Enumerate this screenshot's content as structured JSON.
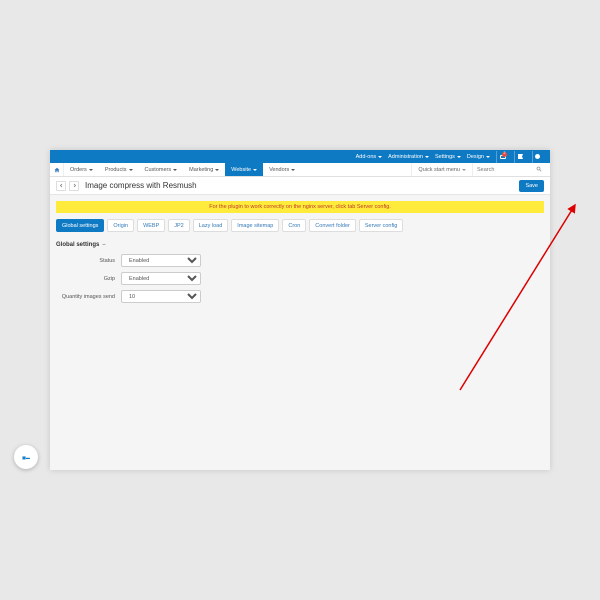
{
  "topbar": {
    "addons": "Add-ons",
    "administration": "Administration",
    "settings": "Settings",
    "design": "Design",
    "cart_badge": "2"
  },
  "nav": {
    "orders": "Orders",
    "products": "Products",
    "customers": "Customers",
    "marketing": "Marketing",
    "website": "Website",
    "vendors": "Vendors",
    "quick_start": "Quick start menu"
  },
  "search": {
    "placeholder": "Search"
  },
  "page": {
    "title": "Image compress with Resmush"
  },
  "actions": {
    "save": "Save"
  },
  "alert": {
    "text": "For the plugin to work correctly on the nginx server, click tab Server config."
  },
  "tabs": {
    "global": "Global settings",
    "origin": "Origin",
    "webp": "WEBP",
    "jp2": "JP2",
    "lazy": "Lazy load",
    "sitemap": "Image sitemap",
    "cron": "Cron",
    "convert": "Convert folder",
    "server": "Server config"
  },
  "section": {
    "title": "Global settings"
  },
  "form": {
    "status_label": "Status",
    "status_value": "Enabled",
    "gzip_label": "Gzip",
    "gzip_value": "Enabled",
    "qty_label": "Quantity images send",
    "qty_value": "10"
  }
}
